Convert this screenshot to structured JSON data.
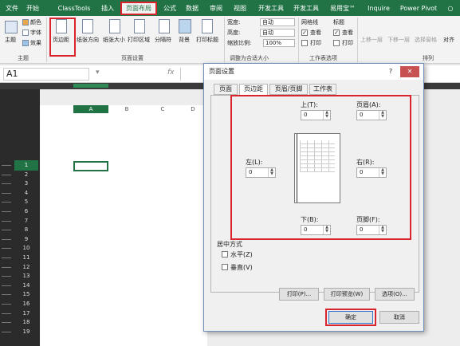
{
  "tabs": [
    "文件",
    "开始",
    "ClassTools",
    "插入",
    "页面布局",
    "公式",
    "数据",
    "审阅",
    "视图",
    "开发工具",
    "开发工具",
    "易用宝™",
    "Inquire",
    "Power Pivot"
  ],
  "active_tab_index": 4,
  "help_icon": "lightbulb-icon",
  "ribbon": {
    "theme_label": "主题",
    "colors_label": "颜色",
    "fonts_label": "字体",
    "effects_label": "效果",
    "themes_group": "主题",
    "margins_label": "页边距",
    "orientation_label": "纸张方向",
    "size_label": "纸张大小",
    "print_area_label": "打印区域",
    "breaks_label": "分隔符",
    "background_label": "背景",
    "print_titles_label": "打印标题",
    "page_setup_group": "页面设置",
    "width_label": "宽度:",
    "height_label": "高度:",
    "scale_label": "缩放比例:",
    "auto1": "自动",
    "auto2": "自动",
    "scale_value": "100%",
    "scale_group": "调整为合适大小",
    "gridlines_label": "网格线",
    "headings_label": "标题",
    "view_label": "查看",
    "print_label": "打印",
    "sheet_opts_group": "工作表选项",
    "bring_forward": "上移一层",
    "send_backward": "下移一层",
    "selection_pane": "选择窗格",
    "align_label": "对齐",
    "arrange_group": "排列"
  },
  "namebox": "A1",
  "fx": "fx",
  "column_headers": [
    "A",
    "B",
    "C",
    "D"
  ],
  "row_numbers": [
    "1",
    "2",
    "3",
    "4",
    "5",
    "6",
    "7",
    "8",
    "9",
    "10",
    "11",
    "12",
    "13",
    "14",
    "15",
    "16",
    "17",
    "18",
    "19"
  ],
  "dialog": {
    "title": "页面设置",
    "help_btn": "?",
    "close_btn": "✕",
    "tabs": [
      "页面",
      "页边距",
      "页眉/页脚",
      "工作表"
    ],
    "active_tab_index": 1,
    "top_label": "上(T):",
    "top_value": "0",
    "header_label": "页眉(A):",
    "header_value": "0",
    "left_label": "左(L):",
    "left_value": "0",
    "right_label": "右(R):",
    "right_value": "0",
    "bottom_label": "下(B):",
    "bottom_value": "0",
    "footer_label": "页脚(F):",
    "footer_value": "0",
    "center_label": "居中方式",
    "horizontal_label": "水平(Z)",
    "vertical_label": "垂直(V)",
    "print_btn": "打印(P)...",
    "preview_btn": "打印预览(W)",
    "options_btn": "选项(O)...",
    "ok_btn": "确定",
    "cancel_btn": "取消"
  }
}
